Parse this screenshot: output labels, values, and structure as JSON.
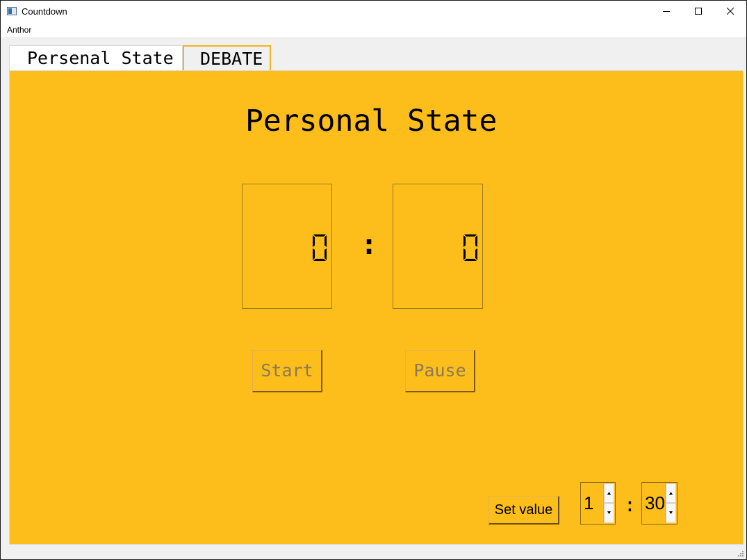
{
  "window": {
    "title": "Countdown",
    "icon": "app-window-icon",
    "controls": [
      "minimize-icon",
      "maximize-icon",
      "close-icon"
    ]
  },
  "menu": {
    "items": [
      {
        "label": "Anthor"
      }
    ]
  },
  "tabs": [
    {
      "label": "Persenal State",
      "selected": true
    },
    {
      "label": "DEBATE",
      "selected": false
    }
  ],
  "panel": {
    "title": "Personal State",
    "display": {
      "minutes": "0",
      "separator": ":",
      "seconds": "0"
    },
    "buttons": {
      "start": "Start",
      "pause": "Pause"
    },
    "setter": {
      "set_label": "Set value",
      "minutes": "1",
      "separator": ":",
      "seconds": "30"
    }
  },
  "colors": {
    "panel_background": "#fdbd1a",
    "debate_tab_border": "#f2b51b",
    "disabled_text": "#8a7a55"
  }
}
